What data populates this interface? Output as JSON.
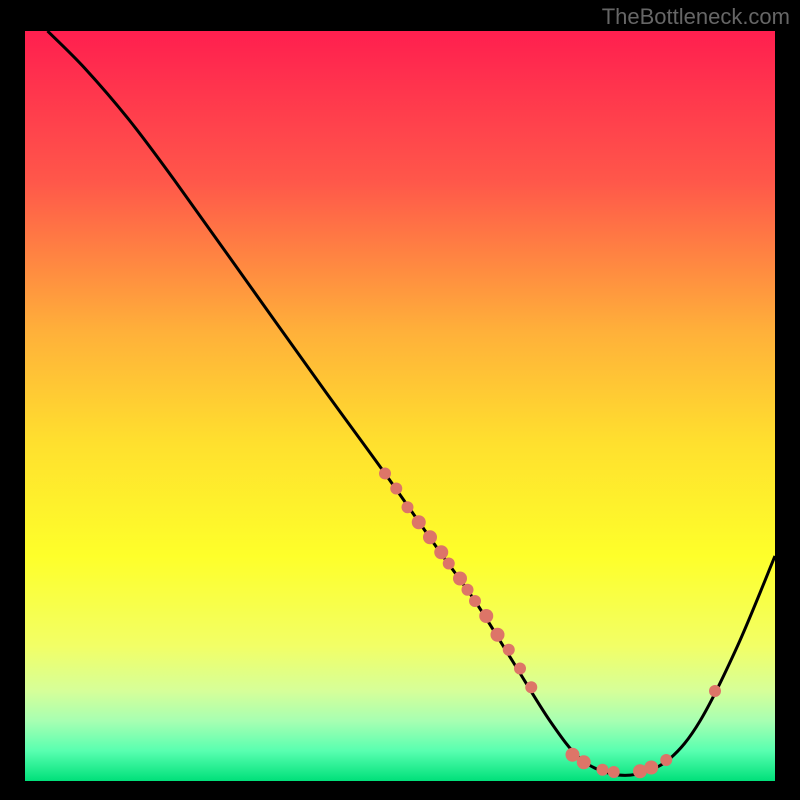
{
  "watermark": "TheBottleneck.com",
  "chart_data": {
    "type": "line",
    "title": "",
    "xlabel": "",
    "ylabel": "",
    "xlim": [
      0,
      100
    ],
    "ylim": [
      0,
      100
    ],
    "gradient_stops": [
      {
        "offset": 0,
        "color": "#ff1f4f"
      },
      {
        "offset": 20,
        "color": "#ff574a"
      },
      {
        "offset": 40,
        "color": "#ffb03a"
      },
      {
        "offset": 55,
        "color": "#ffe02e"
      },
      {
        "offset": 70,
        "color": "#feff2a"
      },
      {
        "offset": 82,
        "color": "#f2ff66"
      },
      {
        "offset": 88,
        "color": "#d6ff99"
      },
      {
        "offset": 92,
        "color": "#a7ffb2"
      },
      {
        "offset": 96,
        "color": "#58ffb0"
      },
      {
        "offset": 100,
        "color": "#00e07a"
      }
    ],
    "curveDescription": "Smooth curve descending from top-left to a minimum near x≈78 where it touches the bottom, then rising toward the right edge",
    "curve": [
      {
        "x": 3,
        "y": 100
      },
      {
        "x": 8,
        "y": 95
      },
      {
        "x": 14,
        "y": 88
      },
      {
        "x": 20,
        "y": 80
      },
      {
        "x": 30,
        "y": 66
      },
      {
        "x": 40,
        "y": 52
      },
      {
        "x": 48,
        "y": 41
      },
      {
        "x": 55,
        "y": 31
      },
      {
        "x": 60,
        "y": 24
      },
      {
        "x": 65,
        "y": 16
      },
      {
        "x": 70,
        "y": 8
      },
      {
        "x": 74,
        "y": 3
      },
      {
        "x": 78,
        "y": 1
      },
      {
        "x": 82,
        "y": 1
      },
      {
        "x": 86,
        "y": 3
      },
      {
        "x": 90,
        "y": 8
      },
      {
        "x": 95,
        "y": 18
      },
      {
        "x": 100,
        "y": 30
      }
    ],
    "dots": [
      {
        "x": 48.0,
        "y": 41.0,
        "r": 6
      },
      {
        "x": 49.5,
        "y": 39.0,
        "r": 6
      },
      {
        "x": 51.0,
        "y": 36.5,
        "r": 6
      },
      {
        "x": 52.5,
        "y": 34.5,
        "r": 7
      },
      {
        "x": 54.0,
        "y": 32.5,
        "r": 7
      },
      {
        "x": 55.5,
        "y": 30.5,
        "r": 7
      },
      {
        "x": 56.5,
        "y": 29.0,
        "r": 6
      },
      {
        "x": 58.0,
        "y": 27.0,
        "r": 7
      },
      {
        "x": 59.0,
        "y": 25.5,
        "r": 6
      },
      {
        "x": 60.0,
        "y": 24.0,
        "r": 6
      },
      {
        "x": 61.5,
        "y": 22.0,
        "r": 7
      },
      {
        "x": 63.0,
        "y": 19.5,
        "r": 7
      },
      {
        "x": 64.5,
        "y": 17.5,
        "r": 6
      },
      {
        "x": 66.0,
        "y": 15.0,
        "r": 6
      },
      {
        "x": 67.5,
        "y": 12.5,
        "r": 6
      },
      {
        "x": 73.0,
        "y": 3.5,
        "r": 7
      },
      {
        "x": 74.5,
        "y": 2.5,
        "r": 7
      },
      {
        "x": 77.0,
        "y": 1.5,
        "r": 6
      },
      {
        "x": 78.5,
        "y": 1.2,
        "r": 6
      },
      {
        "x": 82.0,
        "y": 1.3,
        "r": 7
      },
      {
        "x": 83.5,
        "y": 1.8,
        "r": 7
      },
      {
        "x": 85.5,
        "y": 2.8,
        "r": 6
      },
      {
        "x": 92.0,
        "y": 12.0,
        "r": 6
      }
    ],
    "dot_color": "#dd7568",
    "curve_color": "#000000"
  }
}
